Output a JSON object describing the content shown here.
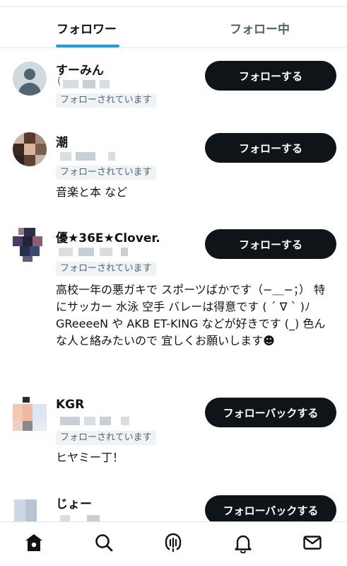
{
  "tabs": [
    {
      "label": "フォロワー",
      "active": true
    },
    {
      "label": "フォロー中",
      "active": false
    }
  ],
  "users": [
    {
      "name": "すーみん",
      "handle_prefix": "(",
      "follows_you": "フォローされています",
      "bio": "",
      "button": "フォローする"
    },
    {
      "name": "潮",
      "follows_you": "フォローされています",
      "bio": "音楽と本 など",
      "button": "フォローする"
    },
    {
      "name": "優★36E★Clover.",
      "follows_you": "フォローされています",
      "bio": "高校一年の悪ガキで スポーツばかです（−＿−；） 特にサッカー 水泳 空手 バレーは得意です ( ´ ∇ ` )ﾉ GReeeeN や AKB ET-KING などが好きです (_) 色んな人と絡みたいので 宜しくお願いします☻",
      "button": "フォローする"
    },
    {
      "name": "KGR",
      "follows_you": "フォローされています",
      "bio": "ヒヤミー丁！",
      "button": "フォローバックする"
    },
    {
      "name": "じょー",
      "follows_you": "",
      "bio": "",
      "button": "フォローバックする"
    }
  ],
  "bottom_nav": [
    {
      "icon": "home-icon",
      "active": true
    },
    {
      "icon": "search-icon",
      "active": false
    },
    {
      "icon": "spaces-icon",
      "active": false
    },
    {
      "icon": "bell-icon",
      "active": false
    },
    {
      "icon": "mail-icon",
      "active": false
    }
  ],
  "colors": {
    "accent": "#1d9bf0",
    "button_bg": "#0f1419",
    "muted": "#536471"
  }
}
